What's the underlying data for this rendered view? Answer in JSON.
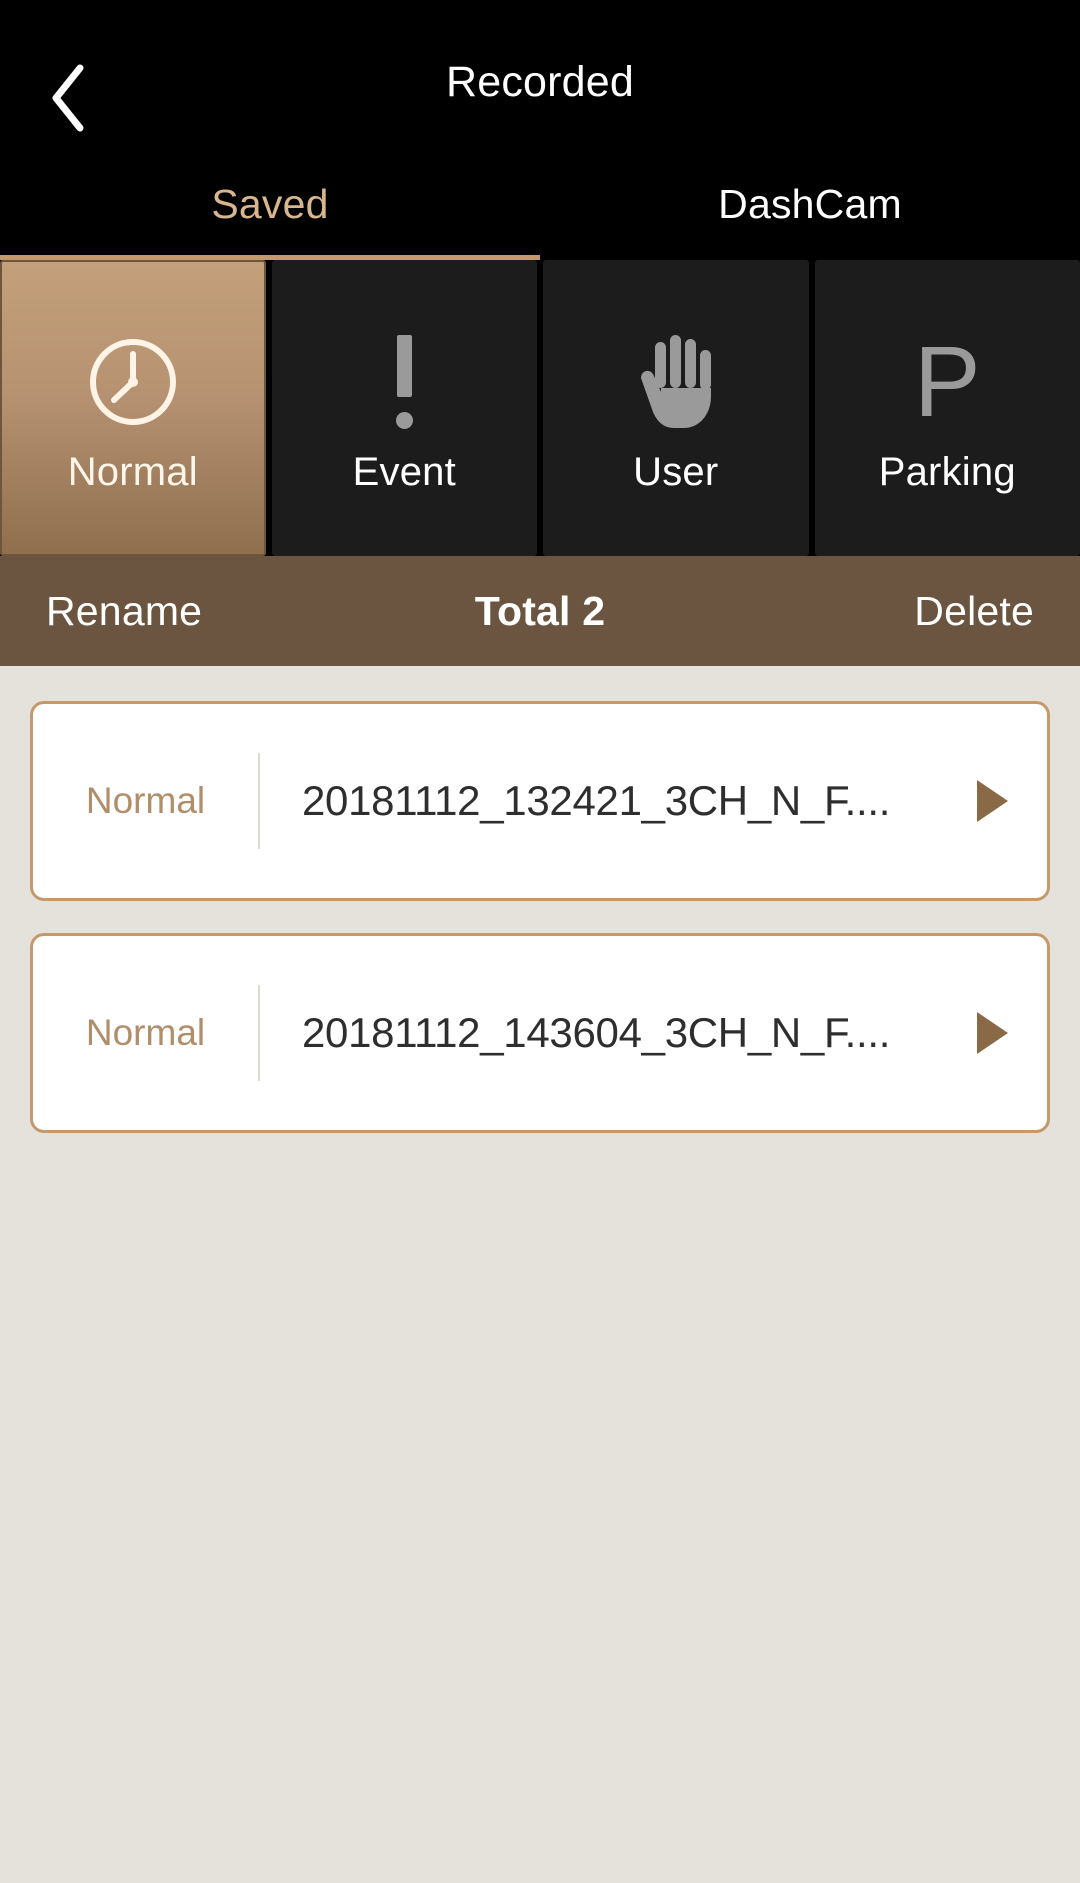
{
  "header": {
    "back_icon": "chevron-left-icon",
    "title": "Recorded"
  },
  "tabs": [
    {
      "label": "Saved",
      "active": true
    },
    {
      "label": "DashCam",
      "active": false
    }
  ],
  "categories": [
    {
      "label": "Normal",
      "icon": "clock-icon",
      "selected": true
    },
    {
      "label": "Event",
      "icon": "exclamation-icon",
      "selected": false
    },
    {
      "label": "User",
      "icon": "hand-icon",
      "selected": false
    },
    {
      "label": "Parking",
      "icon": "letter-p-icon",
      "selected": false
    }
  ],
  "actionbar": {
    "rename_label": "Rename",
    "total_label": "Total 2",
    "delete_label": "Delete"
  },
  "files": [
    {
      "type": "Normal",
      "name": "20181112_132421_3CH_N_F....",
      "play_icon": "play-icon"
    },
    {
      "type": "Normal",
      "name": "20181112_143604_3CH_N_F....",
      "play_icon": "play-icon"
    }
  ],
  "colors": {
    "titlebar_bg": "#000000",
    "accent_tan": "#C49A6C",
    "active_tab_text": "#D8B68E",
    "selected_cat_top": "#C3A07A",
    "selected_cat_bottom": "#8F6F4E",
    "actionbar_bg": "#6B5540",
    "page_bg": "#E5E2DC",
    "card_bg": "#FFFFFF",
    "card_type_text": "#B08E69",
    "play_triangle": "#8A6A46",
    "icon_gray": "#9A9A9A"
  }
}
